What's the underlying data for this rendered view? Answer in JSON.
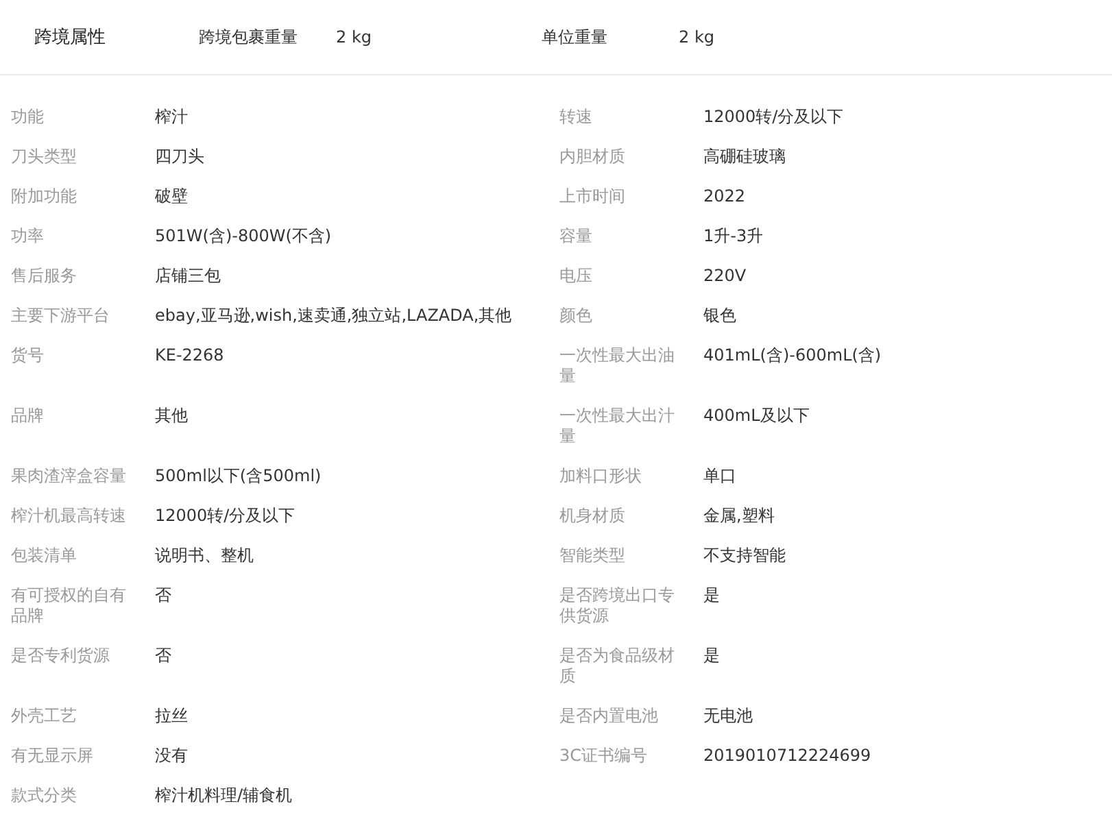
{
  "cross_border": {
    "title": "跨境属性",
    "fields": [
      {
        "label": "跨境包裹重量",
        "value": "2 kg"
      },
      {
        "label": "单位重量",
        "value": "2 kg"
      }
    ]
  },
  "attributes": [
    {
      "label": "功能",
      "value": "榨汁"
    },
    {
      "label": "转速",
      "value": "12000转/分及以下"
    },
    {
      "label": "刀头类型",
      "value": "四刀头"
    },
    {
      "label": "内胆材质",
      "value": "高硼硅玻璃"
    },
    {
      "label": "附加功能",
      "value": "破壁"
    },
    {
      "label": "上市时间",
      "value": "2022"
    },
    {
      "label": "功率",
      "value": "501W(含)-800W(不含)"
    },
    {
      "label": "容量",
      "value": "1升-3升"
    },
    {
      "label": "售后服务",
      "value": "店铺三包"
    },
    {
      "label": "电压",
      "value": "220V"
    },
    {
      "label": "主要下游平台",
      "value": "ebay,亚马逊,wish,速卖通,独立站,LAZADA,其他"
    },
    {
      "label": "颜色",
      "value": "银色"
    },
    {
      "label": "货号",
      "value": "KE-2268"
    },
    {
      "label": "一次性最大出油量",
      "value": "401mL(含)-600mL(含)"
    },
    {
      "label": "品牌",
      "value": "其他"
    },
    {
      "label": "一次性最大出汁量",
      "value": "400mL及以下"
    },
    {
      "label": "果肉渣滓盒容量",
      "value": "500ml以下(含500ml)"
    },
    {
      "label": "加料口形状",
      "value": "单口"
    },
    {
      "label": "榨汁机最高转速",
      "value": "12000转/分及以下"
    },
    {
      "label": "机身材质",
      "value": "金属,塑料"
    },
    {
      "label": "包装清单",
      "value": "说明书、整机"
    },
    {
      "label": "智能类型",
      "value": "不支持智能"
    },
    {
      "label": "有可授权的自有品牌",
      "value": "否"
    },
    {
      "label": "是否跨境出口专供货源",
      "value": "是"
    },
    {
      "label": "是否专利货源",
      "value": "否"
    },
    {
      "label": "是否为食品级材质",
      "value": "是"
    },
    {
      "label": "外壳工艺",
      "value": "拉丝"
    },
    {
      "label": "是否内置电池",
      "value": "无电池"
    },
    {
      "label": "有无显示屏",
      "value": "没有"
    },
    {
      "label": "3C证书编号",
      "value": "2019010712224699"
    },
    {
      "label": "款式分类",
      "value": "榨汁机料理/辅食机"
    }
  ]
}
